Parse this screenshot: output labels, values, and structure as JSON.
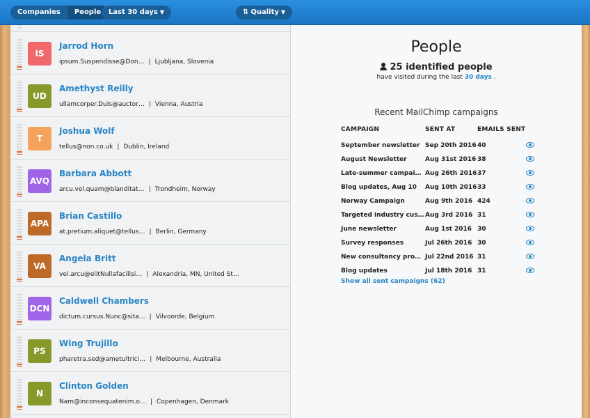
{
  "topbar": {
    "tabs": [
      "Companies",
      "People"
    ],
    "active_tab": "People",
    "range": "Last 30 days",
    "sort": "Quality"
  },
  "people": [
    {
      "initials": "IS",
      "color": "#f0686a",
      "name": "Jarrod Horn",
      "email": "ipsum.Suspendisse@Don…",
      "location": "Ljubljana, Slovenia"
    },
    {
      "initials": "UD",
      "color": "#869a2b",
      "name": "Amethyst Reilly",
      "email": "ullamcorper.Duis@auctor…",
      "location": "Vienna, Austria"
    },
    {
      "initials": "T",
      "color": "#f4a35d",
      "name": "Joshua Wolf",
      "email": "tellus@non.co.uk",
      "location": "Dublin, Ireland"
    },
    {
      "initials": "AVQ",
      "color": "#a064e8",
      "name": "Barbara Abbott",
      "email": "arcu.vel.quam@blanditat…",
      "location": "Trondheim, Norway"
    },
    {
      "initials": "APA",
      "color": "#bd6a28",
      "name": "Brian Castillo",
      "email": "at.pretium.aliquet@tellus…",
      "location": "Berlin, Germany"
    },
    {
      "initials": "VA",
      "color": "#bd6a28",
      "name": "Angela Britt",
      "email": "vel.arcu@elitNullafacilisi…",
      "location": "Alexandria, MN, United St…"
    },
    {
      "initials": "DCN",
      "color": "#a064e8",
      "name": "Caldwell Chambers",
      "email": "dictum.cursus.Nunc@sita…",
      "location": "Vilvoorde, Belgium"
    },
    {
      "initials": "PS",
      "color": "#869a2b",
      "name": "Wing Trujillo",
      "email": "pharetra.sed@ametultrici…",
      "location": "Melbourne, Australia"
    },
    {
      "initials": "N",
      "color": "#869a2b",
      "name": "Clinton Golden",
      "email": "Nam@inconsequatenim.o…",
      "location": "Copenhagen, Denmark"
    }
  ],
  "panel": {
    "title": "People",
    "identified": "25 identified people",
    "visited_prefix": "have visited during the last",
    "visited_link": "30 days",
    "visited_suffix": ".",
    "campaigns_title": "Recent MailChimp campaigns",
    "columns": [
      "CAMPAIGN",
      "SENT AT",
      "EMAILS SENT"
    ],
    "campaigns": [
      {
        "name": "September newsletter",
        "sent": "Sep 20th 2016",
        "emails": "40"
      },
      {
        "name": "August Newsletter",
        "sent": "Aug 31st 2016",
        "emails": "38"
      },
      {
        "name": "Late-summer campai…",
        "sent": "Aug 26th 2016",
        "emails": "37"
      },
      {
        "name": "Blog updates, Aug 10",
        "sent": "Aug 10th 2016",
        "emails": "33"
      },
      {
        "name": "Norway Campaign",
        "sent": "Aug 9th 2016",
        "emails": "424"
      },
      {
        "name": "Targeted industry cus…",
        "sent": "Aug 3rd 2016",
        "emails": "31"
      },
      {
        "name": "June newsletter",
        "sent": "Aug 1st 2016",
        "emails": "30"
      },
      {
        "name": "Survey responses",
        "sent": "Jul 26th 2016",
        "emails": "30"
      },
      {
        "name": "New consultancy pro…",
        "sent": "Jul 22nd 2016",
        "emails": "31"
      },
      {
        "name": "Blog updates",
        "sent": "Jul 18th 2016",
        "emails": "31"
      }
    ],
    "show_all": "Show all sent campaigns (62)",
    "link_color": "#2a85c6"
  }
}
